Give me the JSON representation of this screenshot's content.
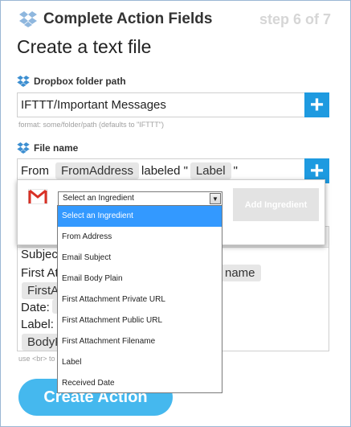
{
  "header": {
    "title": "Complete Action Fields",
    "step": "step 6 of 7"
  },
  "page_title": "Create a text file",
  "folder": {
    "label": "Dropbox folder path",
    "value": "IFTTT/Important Messages",
    "hint": "format: some/folder/path (defaults to \"IFTTT\")"
  },
  "filename": {
    "label": "File name",
    "prefix": "From",
    "token1": "FromAddress",
    "middle": "labeled \"",
    "token2": "Label",
    "suffix": "\""
  },
  "popup": {
    "selected_value": "Select an Ingredient",
    "add_button": "Add Ingredient",
    "options": [
      "Select an Ingredient",
      "From Address",
      "Email Subject",
      "Email Body Plain",
      "First Attachment Private URL",
      "First Attachment Public URL",
      "First Attachment Filename",
      "Label",
      "Received Date"
    ]
  },
  "body": {
    "line1": "Subject",
    "line2_prefix": "First Att",
    "line2_token_tail": "name",
    "line3_token": "FirstA",
    "line4": "Date:",
    "line5": "Label:",
    "line6_token": "BodyP",
    "hint": "use <br> to"
  },
  "create_button": "Create Action",
  "colors": {
    "accent": "#1e9ae0",
    "create": "#45b8ee",
    "selected_option": "#3399ff"
  }
}
